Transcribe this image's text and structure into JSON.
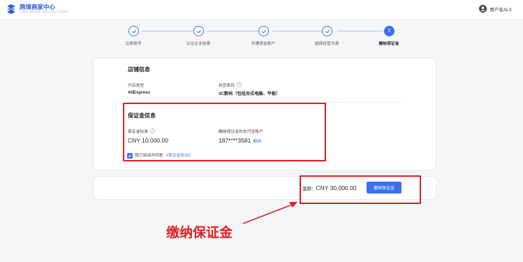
{
  "header": {
    "logo_title": "跨境商家中心",
    "logo_subtitle": "CROSS-BORDER MERCHANT CENTER",
    "username": "用户名ALX"
  },
  "steps": [
    {
      "label": "注册账号",
      "status": "done"
    },
    {
      "label": "认证企业信息",
      "status": "done"
    },
    {
      "label": "开通资金账户",
      "status": "done"
    },
    {
      "label": "选择经营大类",
      "status": "done"
    },
    {
      "label": "缴纳保证金",
      "status": "current",
      "number": "5"
    }
  ],
  "store_info": {
    "title": "店铺信息",
    "store_type_label": "开店类型",
    "store_type_value": "AliExpress",
    "category_label": "经营类目",
    "category_value": "3C数码（包括台式电脑、平板）"
  },
  "deposit_info": {
    "title": "保证金信息",
    "standard_label": "保证金标准",
    "standard_value": "CNY 10,000.00",
    "alipay_label": "缴纳保证金的支付宝账户",
    "alipay_value": "187****3581",
    "unbind_link": "解绑",
    "agree_text": "我已阅读并同意",
    "agree_link": "《保证金协议》",
    "agree_checked": true
  },
  "payment": {
    "total_label": "金额：",
    "total_value": "CNY 30,000.00",
    "pay_button": "缴纳保证金"
  },
  "annotation": {
    "text": "缴纳保证金",
    "color": "#e02020"
  },
  "colors": {
    "primary": "#3b6ff0",
    "annotation_red": "#e02020"
  }
}
